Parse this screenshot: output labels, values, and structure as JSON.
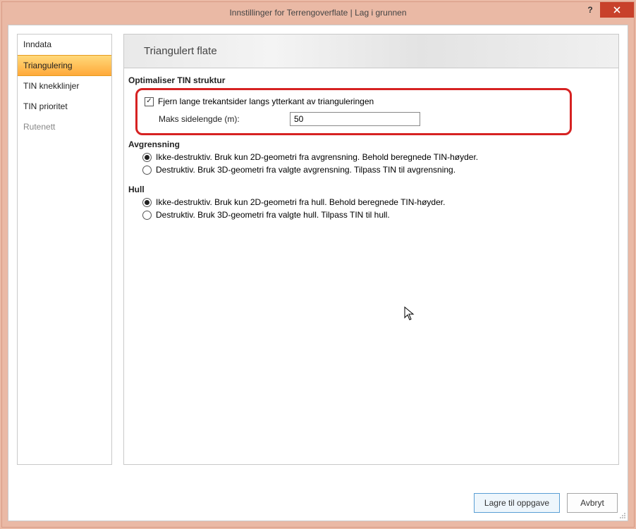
{
  "window": {
    "title": "Innstillinger for Terrengoverflate  |  Lag i grunnen",
    "help": "?",
    "close_icon": "close-icon"
  },
  "sidebar": {
    "items": [
      {
        "label": "Inndata",
        "active": false
      },
      {
        "label": "Triangulering",
        "active": true
      },
      {
        "label": "TIN knekklinjer",
        "active": false
      },
      {
        "label": "TIN prioritet",
        "active": false
      },
      {
        "label": "Rutenett",
        "active": false,
        "muted": true
      }
    ]
  },
  "main": {
    "heading": "Triangulert flate",
    "optimize": {
      "title": "Optimaliser TIN struktur",
      "remove_long_edges_label": "Fjern lange trekantsider langs ytterkant av trianguleringen",
      "remove_long_edges_checked": true,
      "max_side_label": "Maks sidelengde (m):",
      "max_side_value": "50"
    },
    "limitation": {
      "title": "Avgrensning",
      "option_a": "Ikke-destruktiv. Bruk kun 2D-geometri fra avgrensning. Behold beregnede TIN-høyder.",
      "option_b": "Destruktiv. Bruk 3D-geometri fra valgte avgrensning. Tilpass TIN til avgrensning.",
      "selected": "a"
    },
    "hole": {
      "title": "Hull",
      "option_a": "Ikke-destruktiv. Bruk kun 2D-geometri fra hull. Behold beregnede TIN-høyder.",
      "option_b": "Destruktiv. Bruk 3D-geometri fra valgte hull. Tilpass TIN til hull.",
      "selected": "a"
    }
  },
  "footer": {
    "save": "Lagre til oppgave",
    "cancel": "Avbryt"
  }
}
